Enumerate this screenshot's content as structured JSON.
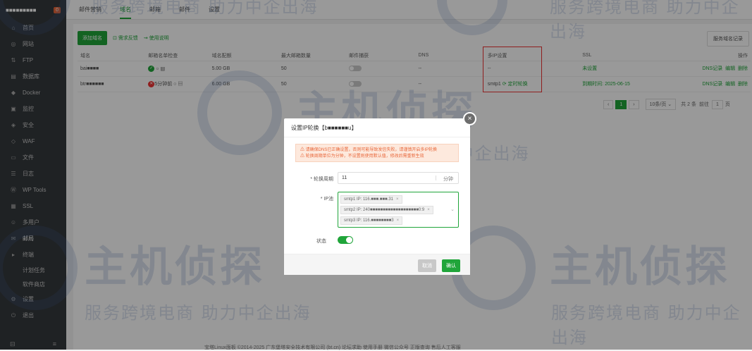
{
  "sidebar": {
    "host": "■■■■■■■■■",
    "badge": "0",
    "items": [
      {
        "label": "首页",
        "icon": "home-icon"
      },
      {
        "label": "网站",
        "icon": "globe-icon"
      },
      {
        "label": "FTP",
        "icon": "ftp-icon"
      },
      {
        "label": "数据库",
        "icon": "database-icon"
      },
      {
        "label": "Docker",
        "icon": "docker-icon"
      },
      {
        "label": "监控",
        "icon": "monitor-icon"
      },
      {
        "label": "安全",
        "icon": "shield-icon"
      },
      {
        "label": "WAF",
        "icon": "waf-icon"
      },
      {
        "label": "文件",
        "icon": "folder-icon"
      },
      {
        "label": "日志",
        "icon": "log-icon"
      },
      {
        "label": "WP Tools",
        "icon": "wordpress-icon"
      },
      {
        "label": "SSL",
        "icon": "ssl-icon"
      },
      {
        "label": "多用户",
        "icon": "users-icon"
      },
      {
        "label": "邮局",
        "icon": "mail-icon"
      },
      {
        "label": "终端",
        "icon": "terminal-icon"
      },
      {
        "label": "计划任务",
        "icon": "clock-icon"
      },
      {
        "label": "软件商店",
        "icon": "store-icon"
      },
      {
        "label": "设置",
        "icon": "gear-icon"
      },
      {
        "label": "退出",
        "icon": "logout-icon"
      }
    ]
  },
  "tabs": [
    "邮件营销",
    "域名",
    "邮箱",
    "邮件",
    "设置"
  ],
  "toolbar": {
    "add_domain": "添加域名",
    "feedback": "需求反馈",
    "manual": "使用说明",
    "logs": "服务域名记录"
  },
  "table": {
    "headers": [
      "域名",
      "邮箱名单检查",
      "域名配额",
      "最大邮箱数量",
      "邮件捕获",
      "DNS",
      "多IP设置",
      "SSL",
      "操作"
    ],
    "rows": [
      {
        "domain": "bai■■■■",
        "check": "",
        "quota": "5.00 GB",
        "max": "50",
        "dns": "--",
        "multi_ip": "--",
        "ip_link": "",
        "ssl": "未设置",
        "ops": [
          "DNS记录",
          "编辑",
          "删除"
        ]
      },
      {
        "domain": "btr■■■■■■",
        "check": "5分钟前",
        "quota": "6.00 GB",
        "max": "50",
        "dns": "--",
        "multi_ip": "smtp1",
        "ip_link": "定时轮换",
        "ssl": "到期时间: 2025-06-15",
        "ops": [
          "DNS记录",
          "编辑",
          "删除"
        ]
      }
    ]
  },
  "pager": {
    "prev": "‹",
    "page": "1",
    "next": "›",
    "per_page": "10条/页",
    "total": "共 2 条",
    "goto": "前往",
    "goto_val": "1",
    "unit": "页"
  },
  "dialog": {
    "title": "设置IP轮换【b■■■■■■u】",
    "warn1": "请确保DNS已正确设置，否则可能导致发信失败，请谨慎开启多IP轮换",
    "warn2": "轮换周期单位为分钟，不设置则使用默认值，修改后需重新生效",
    "period_label": "* 轮换周期",
    "period_value": "11",
    "period_unit": "分钟",
    "ip_label": "* IP池",
    "ips": [
      "smtp1  IP: 116.■■■.■■■.31",
      "smtp2  IP: 240■■■■■■■■■■■■■■■■■■■0:9",
      "smtp3  IP: 116.■■■■■■■■3"
    ],
    "status_label": "状态",
    "cancel": "取消",
    "ok": "确认"
  },
  "footer": "宝塔Linux面板 ©2014-2025 广东堡塔安全技术有限公司 (bt.cn)   论坛求助   使用手册   微信公众号   正版查询   售后人工客服",
  "watermark": {
    "brand": "主机侦探",
    "slogan": "服务跨境电商 助力中企出海"
  }
}
